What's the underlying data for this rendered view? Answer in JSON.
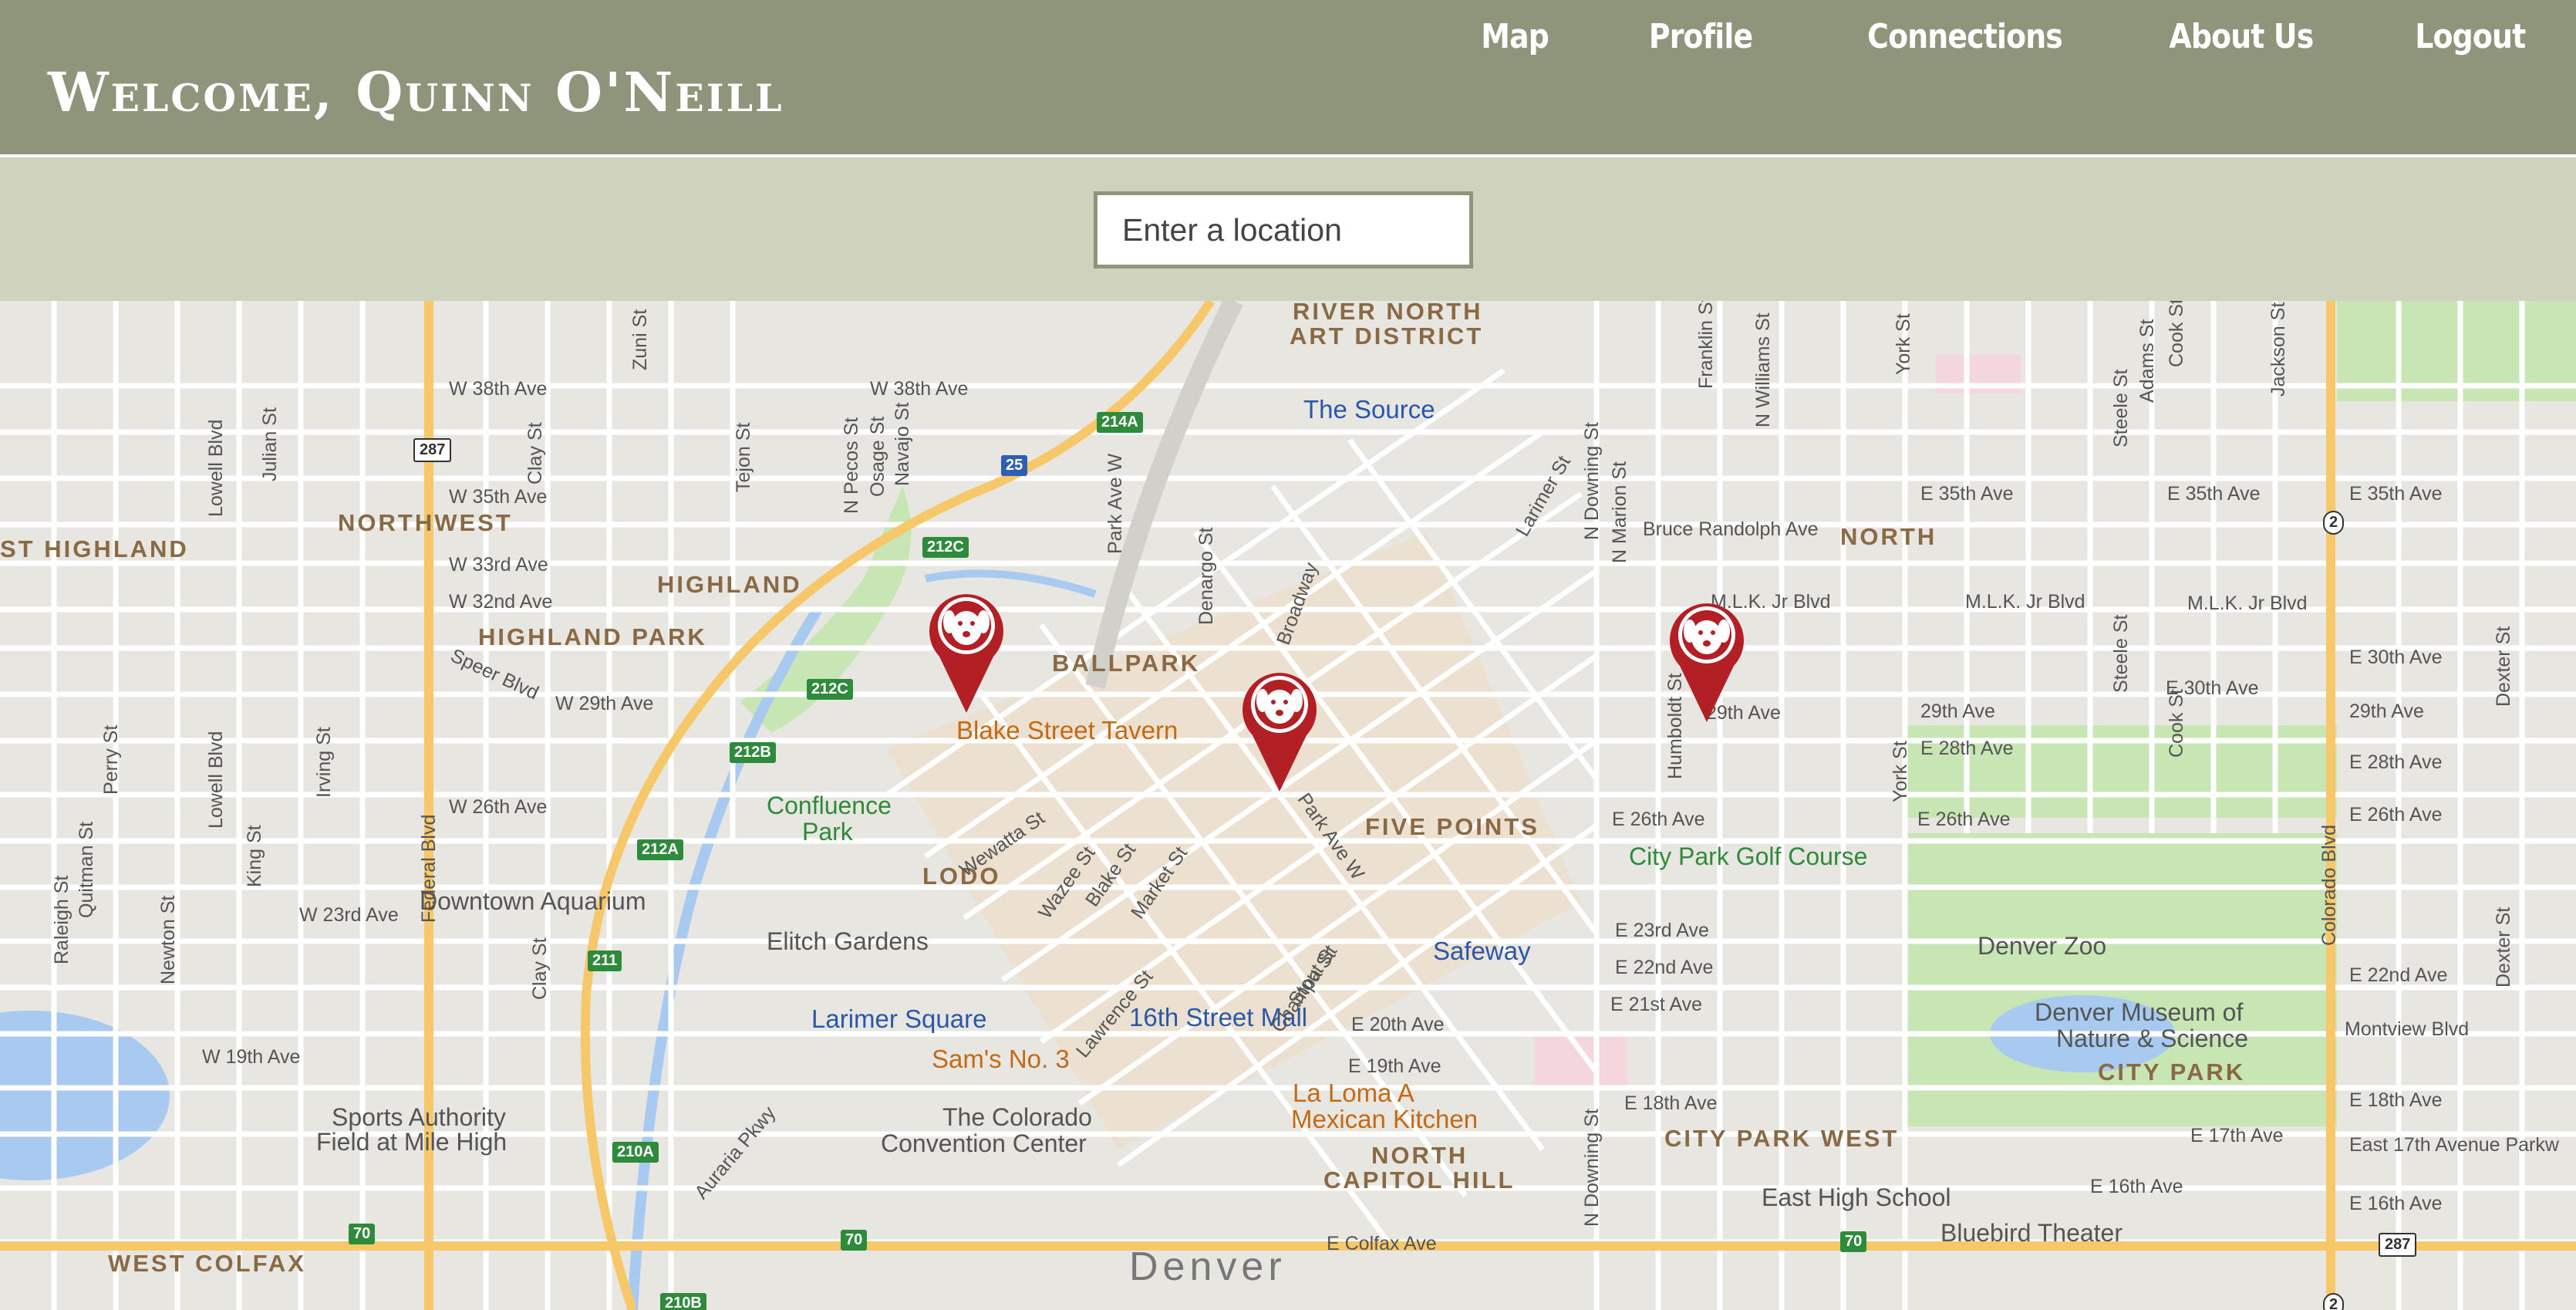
{
  "header": {
    "welcome": "Welcome, Quinn O'Neill",
    "nav": [
      "Map",
      "Profile",
      "Connections",
      "About Us",
      "Logout"
    ]
  },
  "search": {
    "placeholder": "Enter a location"
  },
  "map": {
    "colors": {
      "background": "#e8e6e1",
      "street": "#ffffff",
      "highway": "#f6c86a",
      "park": "#c7e6b4",
      "water": "#a8c9f0",
      "marker": "#b21f24"
    },
    "labels": {
      "hoods": [
        "RIVER NORTH",
        "ART DISTRICT",
        "NORTHWEST",
        "HIGHLAND",
        "HIGHLAND PARK",
        "ST HIGHLAND",
        "BALLPARK",
        "FIVE POINTS",
        "LODO",
        "NORTH",
        "CITY PARK WEST",
        "NORTH",
        "CAPITOL HILL",
        "WEST COLFAX",
        "CITY PARK"
      ],
      "poi_blue": [
        "The Source",
        "Safeway",
        "Larimer Square",
        "16th Street Mall"
      ],
      "poi_orange": [
        "Blake Street Tavern",
        "Sam's No. 3",
        "La Loma A",
        "Mexican Kitchen"
      ],
      "poi_gray": [
        "Downtown Aquarium",
        "Elitch Gardens",
        "Sports Authority",
        "Field at Mile High",
        "The Colorado",
        "Convention Center",
        "Denver Zoo",
        "Denver Museum of",
        "Nature & Science",
        "East High School",
        "Bluebird Theater"
      ],
      "poi_green": [
        "Confluence",
        "Park",
        "City Park Golf Course"
      ],
      "city": "Denver",
      "streets": [
        "W 38th Ave",
        "W 38th Ave",
        "W 35th Ave",
        "W 33rd Ave",
        "W 32nd Ave",
        "W 29th Ave",
        "W 26th Ave",
        "W 23rd Ave",
        "W 19th Ave",
        "E 35th Ave",
        "E 35th Ave",
        "E 35th Ave",
        "Bruce Randolph Ave",
        "M.L.K. Jr Blvd",
        "M.L.K. Jr Blvd",
        "M.L.K. Jr Blvd",
        "E 30th Ave",
        "E 30th Ave",
        "29th Ave",
        "29th Ave",
        "29th Ave",
        "E 28th Ave",
        "E 28th Ave",
        "E 26th Ave",
        "E 26th Ave",
        "E 26th Ave",
        "E 23rd Ave",
        "E 22nd Ave",
        "E 22nd Ave",
        "E 21st Ave",
        "E 20th Ave",
        "E 19th Ave",
        "E 18th Ave",
        "E 18th Ave",
        "E 17th Ave",
        "East 17th Avenue Parkw",
        "E 16th Ave",
        "E 16th Ave",
        "Montview Blvd",
        "E Colfax Ave",
        "Speer Blvd",
        "Wewatta St",
        "Wazee St",
        "Blake St",
        "Market St",
        "Lawrence St",
        "Champa St",
        "Stout St",
        "Park Ave W",
        "Auraria Pkwy",
        "Speer"
      ],
      "vstreets": [
        "Lowell Blvd",
        "Julian St",
        "Zuni St",
        "Clay St",
        "Tejon St",
        "N Pecos St",
        "Osage St",
        "Navajo St",
        "Perry St",
        "Irving St",
        "Lowell Blvd",
        "Federal Blvd",
        "King St",
        "Quitman St",
        "Raleigh St",
        "Newton St",
        "Clay St",
        "Franklin St",
        "N Williams St",
        "York St",
        "Steele St",
        "Cook St",
        "Adams St",
        "Jackson St",
        "N Downing St",
        "N Marion St",
        "Steele St",
        "Cook St",
        "York St",
        "Colorado Blvd",
        "Dexter St",
        "Dexter St",
        "Humboldt St",
        "N Downing St",
        "Park Ave W",
        "Broadway",
        "Denargo St",
        "Larimer St"
      ],
      "shields": [
        "287",
        "25",
        "214A",
        "212C",
        "212C",
        "212B",
        "212A",
        "211",
        "210A",
        "70",
        "70",
        "70",
        "2",
        "2",
        "287",
        "210B"
      ]
    },
    "markers": 3
  }
}
